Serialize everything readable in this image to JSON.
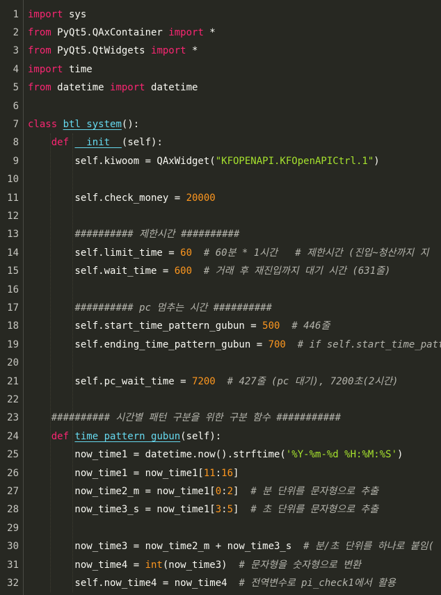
{
  "editor": {
    "colors": {
      "background": "#272822",
      "keyword": "#f92672",
      "function": "#66d9ef",
      "string": "#a6e22e",
      "number": "#fd971f",
      "comment": "#b4b4ac",
      "text": "#f8f8f2"
    },
    "lines": [
      {
        "n": "1",
        "tokens": [
          [
            "kw",
            "import"
          ],
          [
            "plain",
            " sys"
          ]
        ]
      },
      {
        "n": "2",
        "tokens": [
          [
            "kw",
            "from"
          ],
          [
            "plain",
            " PyQt5.QAxContainer "
          ],
          [
            "kw",
            "import"
          ],
          [
            "plain",
            " *"
          ]
        ]
      },
      {
        "n": "3",
        "tokens": [
          [
            "kw",
            "from"
          ],
          [
            "plain",
            " PyQt5.QtWidgets "
          ],
          [
            "kw",
            "import"
          ],
          [
            "plain",
            " *"
          ]
        ]
      },
      {
        "n": "4",
        "tokens": [
          [
            "kw",
            "import"
          ],
          [
            "plain",
            " time"
          ]
        ]
      },
      {
        "n": "5",
        "tokens": [
          [
            "kw",
            "from"
          ],
          [
            "plain",
            " datetime "
          ],
          [
            "kw",
            "import"
          ],
          [
            "plain",
            " datetime"
          ]
        ]
      },
      {
        "n": "6",
        "tokens": []
      },
      {
        "n": "7",
        "tokens": [
          [
            "kw",
            "class"
          ],
          [
            "plain",
            " "
          ],
          [
            "fn",
            "btl_system"
          ],
          [
            "plain",
            "():"
          ]
        ]
      },
      {
        "n": "8",
        "tokens": [
          [
            "plain",
            "    "
          ],
          [
            "kw",
            "def"
          ],
          [
            "plain",
            " "
          ],
          [
            "fn",
            "__init__"
          ],
          [
            "plain",
            "(self):"
          ]
        ]
      },
      {
        "n": "9",
        "tokens": [
          [
            "plain",
            "        self.kiwoom = QAxWidget("
          ],
          [
            "str",
            "\"KFOPENAPI.KFOpenAPICtrl.1\""
          ],
          [
            "plain",
            ")"
          ]
        ]
      },
      {
        "n": "10",
        "tokens": []
      },
      {
        "n": "11",
        "tokens": [
          [
            "plain",
            "        self.check_money = "
          ],
          [
            "num",
            "20000"
          ]
        ]
      },
      {
        "n": "12",
        "tokens": []
      },
      {
        "n": "13",
        "tokens": [
          [
            "plain",
            "        "
          ],
          [
            "com",
            "########## 제한시간 ##########"
          ]
        ]
      },
      {
        "n": "14",
        "tokens": [
          [
            "plain",
            "        self.limit_time = "
          ],
          [
            "num",
            "60"
          ],
          [
            "plain",
            "  "
          ],
          [
            "com",
            "# 60분 * 1시간   # 제한시간 (진입~청산까지 지"
          ]
        ]
      },
      {
        "n": "15",
        "tokens": [
          [
            "plain",
            "        self.wait_time = "
          ],
          [
            "num",
            "600"
          ],
          [
            "plain",
            "  "
          ],
          [
            "com",
            "# 거래 후 재진입까지 대기 시간 (631줄)"
          ]
        ]
      },
      {
        "n": "16",
        "tokens": []
      },
      {
        "n": "17",
        "tokens": [
          [
            "plain",
            "        "
          ],
          [
            "com",
            "########## pc 멈추는 시간 ##########"
          ]
        ]
      },
      {
        "n": "18",
        "tokens": [
          [
            "plain",
            "        self.start_time_pattern_gubun = "
          ],
          [
            "num",
            "500"
          ],
          [
            "plain",
            "  "
          ],
          [
            "com",
            "# 446줄"
          ]
        ]
      },
      {
        "n": "19",
        "tokens": [
          [
            "plain",
            "        self.ending_time_pattern_gubun = "
          ],
          [
            "num",
            "700"
          ],
          [
            "plain",
            "  "
          ],
          [
            "com",
            "# if self.start_time_pattern_"
          ]
        ]
      },
      {
        "n": "20",
        "tokens": []
      },
      {
        "n": "21",
        "tokens": [
          [
            "plain",
            "        self.pc_wait_time = "
          ],
          [
            "num",
            "7200"
          ],
          [
            "plain",
            "  "
          ],
          [
            "com",
            "# 427줄 (pc 대기), 7200초(2시간)"
          ]
        ]
      },
      {
        "n": "22",
        "tokens": []
      },
      {
        "n": "23",
        "tokens": [
          [
            "plain",
            "    "
          ],
          [
            "com",
            "########## 시간별 패턴 구분을 위한 구분 함수 ###########"
          ]
        ]
      },
      {
        "n": "24",
        "tokens": [
          [
            "plain",
            "    "
          ],
          [
            "kw",
            "def"
          ],
          [
            "plain",
            " "
          ],
          [
            "fn",
            "time_pattern_gubun"
          ],
          [
            "plain",
            "(self):"
          ]
        ]
      },
      {
        "n": "25",
        "tokens": [
          [
            "plain",
            "        now_time1 = datetime.now().strftime("
          ],
          [
            "str",
            "'%Y-%m-%d %H:%M:%S'"
          ],
          [
            "plain",
            ")"
          ]
        ]
      },
      {
        "n": "26",
        "tokens": [
          [
            "plain",
            "        now_time1 = now_time1["
          ],
          [
            "num",
            "11"
          ],
          [
            "plain",
            ":"
          ],
          [
            "num",
            "16"
          ],
          [
            "plain",
            "]"
          ]
        ]
      },
      {
        "n": "27",
        "tokens": [
          [
            "plain",
            "        now_time2_m = now_time1["
          ],
          [
            "num",
            "0"
          ],
          [
            "plain",
            ":"
          ],
          [
            "num",
            "2"
          ],
          [
            "plain",
            "]  "
          ],
          [
            "com",
            "# 분 단위를 문자형으로 추출"
          ]
        ]
      },
      {
        "n": "28",
        "tokens": [
          [
            "plain",
            "        now_time3_s = now_time1["
          ],
          [
            "num",
            "3"
          ],
          [
            "plain",
            ":"
          ],
          [
            "num",
            "5"
          ],
          [
            "plain",
            "]  "
          ],
          [
            "com",
            "# 초 단위를 문자형으로 추출"
          ]
        ]
      },
      {
        "n": "29",
        "tokens": []
      },
      {
        "n": "30",
        "tokens": [
          [
            "plain",
            "        now_time3 = now_time2_m + now_time3_s  "
          ],
          [
            "com",
            "# 분/초 단위를 하나로 붙임("
          ]
        ]
      },
      {
        "n": "31",
        "tokens": [
          [
            "plain",
            "        now_time4 = "
          ],
          [
            "bi",
            "int"
          ],
          [
            "plain",
            "(now_time3)  "
          ],
          [
            "com",
            "# 문자형을 숫자형으로 변환"
          ]
        ]
      },
      {
        "n": "32",
        "tokens": [
          [
            "plain",
            "        self.now_time4 = now_time4  "
          ],
          [
            "com",
            "# 전역변수로 pi_check1에서 활용"
          ]
        ]
      }
    ]
  }
}
